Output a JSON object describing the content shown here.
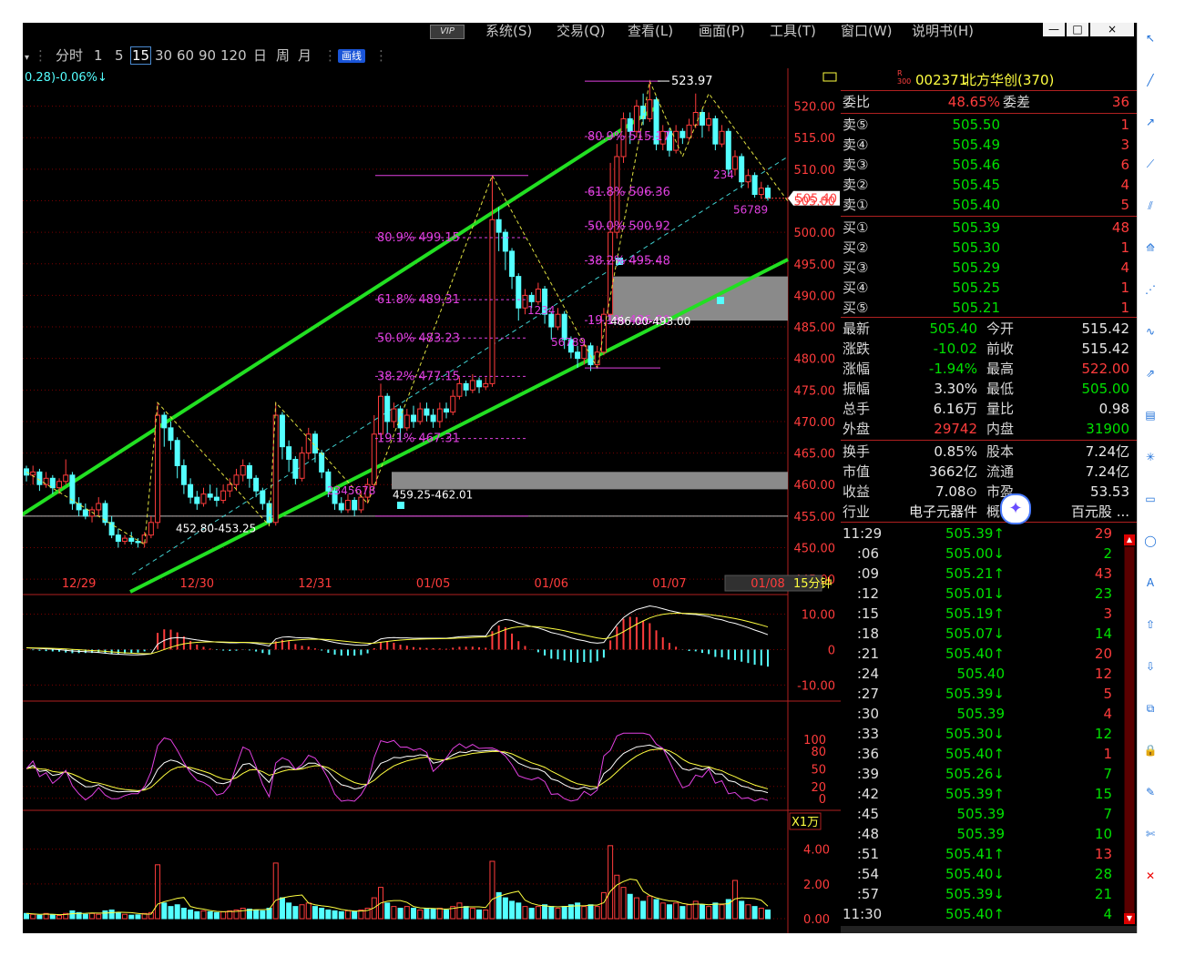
{
  "menu": {
    "vip": "VIP",
    "items": [
      "系统(S)",
      "交易(Q)",
      "查看(L)",
      "画面(P)",
      "工具(T)",
      "窗口(W)",
      "说明书(H)"
    ],
    "window_buttons": [
      "—",
      "□",
      "×"
    ]
  },
  "periods": {
    "items": [
      "分时",
      "1",
      "5",
      "15",
      "30",
      "60",
      "90",
      "120",
      "日",
      "周",
      "月"
    ],
    "selected": "15",
    "draw_label": "画线"
  },
  "chart": {
    "change_text": "0.28)-0.06%↓",
    "price_axis": [
      "520.00",
      "515.00",
      "510.00",
      "505.00",
      "500.00",
      "495.00",
      "490.00",
      "485.00",
      "480.00",
      "475.00",
      "470.00",
      "465.00",
      "460.00",
      "455.00",
      "450.00",
      "445.00"
    ],
    "current_price_tag": "505.40",
    "high_label": "523.97",
    "dates": [
      "12/29",
      "12/30",
      "12/31",
      "01/05",
      "01/06",
      "01/07",
      "01/08"
    ],
    "period_label": "15分钟",
    "fib_left": [
      "80.9% 499.15",
      "61.8% 489.31",
      "50.0% 483.23",
      "38.2% 477.15",
      "19.1% 467.31"
    ],
    "fib_right": [
      "80.9% 515.17",
      "61.8% 506.36",
      "50.0% 500.92",
      "38.2% 495.48",
      "19.1% 486.00"
    ],
    "gap_lower": "459.25-462.01",
    "gap_upper": "486.00-493.00",
    "support_label": "452.80-453.25",
    "macd_axis": [
      "10.00",
      "0",
      "-10.00"
    ],
    "kdj_axis": [
      "100",
      "80",
      "50",
      "20",
      "0"
    ],
    "vol_unit": "X1万",
    "vol_axis": [
      "4.00",
      "2.00",
      "0.00"
    ],
    "nine_turn_a": "2345678",
    "nine_turn_b": "1234",
    "nine_turn_c": "56789",
    "nine_turn_d": "234",
    "nine_turn_e": "56789"
  },
  "stock": {
    "code": "002371",
    "name": "北方华创(370)",
    "badge_top": "R",
    "badge_bottom": "300"
  },
  "order_book": {
    "weibi_label": "委比",
    "weibi": "48.65%",
    "weicha_label": "委差",
    "weicha": "36",
    "sells": [
      {
        "label": "卖⑤",
        "price": "505.50",
        "vol": "1"
      },
      {
        "label": "卖④",
        "price": "505.49",
        "vol": "3"
      },
      {
        "label": "卖③",
        "price": "505.46",
        "vol": "6"
      },
      {
        "label": "卖②",
        "price": "505.45",
        "vol": "4"
      },
      {
        "label": "卖①",
        "price": "505.40",
        "vol": "5"
      }
    ],
    "buys": [
      {
        "label": "买①",
        "price": "505.39",
        "vol": "48"
      },
      {
        "label": "买②",
        "price": "505.30",
        "vol": "1"
      },
      {
        "label": "买③",
        "price": "505.29",
        "vol": "4"
      },
      {
        "label": "买④",
        "price": "505.25",
        "vol": "1"
      },
      {
        "label": "买⑤",
        "price": "505.21",
        "vol": "1"
      }
    ]
  },
  "stats": [
    {
      "l1": "最新",
      "v1": "505.40",
      "c1": "grn",
      "l2": "今开",
      "v2": "515.42",
      "c2": "wht"
    },
    {
      "l1": "涨跌",
      "v1": "-10.02",
      "c1": "grn",
      "l2": "前收",
      "v2": "515.42",
      "c2": "wht"
    },
    {
      "l1": "涨幅",
      "v1": "-1.94%",
      "c1": "grn",
      "l2": "最高",
      "v2": "522.00",
      "c2": "red"
    },
    {
      "l1": "振幅",
      "v1": "3.30%",
      "c1": "wht",
      "l2": "最低",
      "v2": "505.00",
      "c2": "grn"
    },
    {
      "l1": "总手",
      "v1": "6.16万",
      "c1": "wht",
      "l2": "量比",
      "v2": "0.98",
      "c2": "wht"
    },
    {
      "l1": "外盘",
      "v1": "29742",
      "c1": "red",
      "l2": "内盘",
      "v2": "31900",
      "c2": "grn"
    }
  ],
  "fundamentals": [
    {
      "l1": "换手",
      "v1": "0.85%",
      "l2": "股本",
      "v2": "7.24亿"
    },
    {
      "l1": "市值",
      "v1": "3662亿",
      "l2": "流通",
      "v2": "7.24亿"
    },
    {
      "l1": "收益",
      "v1": "7.08⊙",
      "l2": "市盈",
      "v2": "53.53"
    },
    {
      "l1": "行业",
      "v1": "电子元器件",
      "l2": "概",
      "v2": "百元股 ..."
    }
  ],
  "ticks": [
    {
      "t": "11:29",
      "p": "505.39↑",
      "pc": "grn",
      "v": "29",
      "vc": "red"
    },
    {
      "t": ":06",
      "p": "505.00↓",
      "pc": "grn",
      "v": "2",
      "vc": "grn"
    },
    {
      "t": ":09",
      "p": "505.21↑",
      "pc": "grn",
      "v": "43",
      "vc": "red"
    },
    {
      "t": ":12",
      "p": "505.01↓",
      "pc": "grn",
      "v": "23",
      "vc": "grn"
    },
    {
      "t": ":15",
      "p": "505.19↑",
      "pc": "grn",
      "v": "3",
      "vc": "red"
    },
    {
      "t": ":18",
      "p": "505.07↓",
      "pc": "grn",
      "v": "14",
      "vc": "grn"
    },
    {
      "t": ":21",
      "p": "505.40↑",
      "pc": "grn",
      "v": "20",
      "vc": "red"
    },
    {
      "t": ":24",
      "p": "505.40",
      "pc": "grn",
      "v": "12",
      "vc": "red"
    },
    {
      "t": ":27",
      "p": "505.39↓",
      "pc": "grn",
      "v": "5",
      "vc": "red"
    },
    {
      "t": ":30",
      "p": "505.39",
      "pc": "grn",
      "v": "4",
      "vc": "red"
    },
    {
      "t": ":33",
      "p": "505.30↓",
      "pc": "grn",
      "v": "12",
      "vc": "grn"
    },
    {
      "t": ":36",
      "p": "505.40↑",
      "pc": "grn",
      "v": "1",
      "vc": "red"
    },
    {
      "t": ":39",
      "p": "505.26↓",
      "pc": "grn",
      "v": "7",
      "vc": "grn"
    },
    {
      "t": ":42",
      "p": "505.39↑",
      "pc": "grn",
      "v": "15",
      "vc": "grn"
    },
    {
      "t": ":45",
      "p": "505.39",
      "pc": "grn",
      "v": "7",
      "vc": "grn"
    },
    {
      "t": ":48",
      "p": "505.39",
      "pc": "grn",
      "v": "10",
      "vc": "grn"
    },
    {
      "t": ":51",
      "p": "505.41↑",
      "pc": "grn",
      "v": "13",
      "vc": "red"
    },
    {
      "t": ":54",
      "p": "505.40↓",
      "pc": "grn",
      "v": "28",
      "vc": "grn"
    },
    {
      "t": ":57",
      "p": "505.39↓",
      "pc": "grn",
      "v": "21",
      "vc": "grn"
    },
    {
      "t": "11:30",
      "p": "505.40↑",
      "pc": "grn",
      "v": "4",
      "vc": "grn"
    }
  ],
  "colors": {
    "up": "#ff3c3c",
    "down": "#54ffff",
    "channel": "#22e022",
    "fib": "#e040e0",
    "grid": "#7a0000"
  },
  "tool_icons": [
    "pointer-icon",
    "line-icon",
    "ray-icon",
    "segment-icon",
    "parallel-icon",
    "channel-icon",
    "fan-icon",
    "wave-icon",
    "arrow-icon",
    "fib-icon",
    "gann-icon",
    "rect-icon",
    "ellipse-icon",
    "text-icon",
    "up-arrow-icon",
    "down-arrow-icon",
    "copy-icon",
    "lock-icon",
    "brush-icon",
    "eraser-icon",
    "close-icon"
  ],
  "chart_data": {
    "type": "candlestick",
    "title": "",
    "ylim": [
      443,
      526
    ],
    "candles": [
      [
        462.5,
        461.5,
        463.0,
        460.5
      ],
      [
        461.5,
        462.0,
        463.0,
        460.0
      ],
      [
        462.0,
        460.0,
        462.5,
        459.0
      ],
      [
        460.0,
        461.0,
        462.0,
        459.5
      ],
      [
        461.0,
        459.5,
        461.5,
        458.5
      ],
      [
        459.5,
        460.5,
        461.0,
        458.5
      ],
      [
        460.5,
        461.5,
        464.0,
        460.0
      ],
      [
        461.5,
        457.0,
        462.0,
        456.0
      ],
      [
        457.0,
        456.0,
        458.0,
        455.0
      ],
      [
        456.0,
        455.0,
        457.0,
        454.5
      ],
      [
        455.0,
        456.0,
        456.5,
        454.0
      ],
      [
        456.0,
        457.0,
        458.0,
        455.0
      ],
      [
        457.0,
        454.0,
        457.5,
        453.5
      ],
      [
        454.0,
        452.0,
        455.0,
        451.5
      ],
      [
        452.0,
        451.0,
        453.0,
        450.0
      ],
      [
        451.0,
        451.5,
        452.0,
        450.5
      ],
      [
        451.5,
        451.0,
        452.5,
        450.5
      ],
      [
        451.0,
        450.8,
        451.5,
        450.0
      ],
      [
        450.8,
        452.0,
        452.5,
        450.0
      ],
      [
        452.0,
        454.0,
        455.0,
        451.5
      ],
      [
        454.0,
        471.0,
        473.0,
        453.0
      ],
      [
        471.0,
        469.0,
        471.5,
        466.0
      ],
      [
        469.0,
        467.0,
        470.0,
        465.5
      ],
      [
        467.0,
        463.0,
        467.5,
        461.0
      ],
      [
        463.0,
        460.0,
        464.0,
        458.5
      ],
      [
        460.0,
        458.0,
        461.0,
        457.0
      ],
      [
        458.0,
        457.0,
        459.0,
        456.0
      ],
      [
        457.0,
        458.5,
        459.5,
        456.5
      ],
      [
        458.5,
        458.0,
        460.0,
        457.5
      ],
      [
        458.0,
        457.5,
        459.5,
        456.5
      ],
      [
        457.5,
        459.0,
        460.0,
        457.0
      ],
      [
        459.0,
        460.0,
        461.0,
        458.0
      ],
      [
        460.0,
        461.5,
        462.5,
        459.0
      ],
      [
        461.5,
        463.0,
        464.0,
        460.5
      ],
      [
        463.0,
        461.0,
        463.5,
        459.5
      ],
      [
        461.0,
        459.0,
        461.5,
        458.0
      ],
      [
        459.0,
        457.0,
        459.5,
        456.0
      ],
      [
        457.0,
        454.0,
        457.5,
        453.5
      ],
      [
        454.0,
        471.0,
        473.0,
        453.5
      ],
      [
        471.0,
        466.0,
        471.5,
        464.0
      ],
      [
        466.0,
        464.0,
        467.0,
        462.0
      ],
      [
        464.0,
        461.0,
        464.5,
        460.0
      ],
      [
        461.0,
        465.0,
        466.0,
        460.5
      ],
      [
        465.0,
        468.0,
        469.0,
        464.0
      ],
      [
        468.0,
        465.0,
        468.5,
        463.5
      ],
      [
        465.0,
        462.0,
        465.5,
        461.0
      ],
      [
        462.0,
        459.0,
        462.5,
        458.0
      ],
      [
        459.0,
        457.0,
        459.5,
        456.0
      ],
      [
        457.0,
        456.0,
        458.0,
        455.5
      ],
      [
        456.0,
        457.5,
        458.5,
        455.5
      ],
      [
        457.5,
        456.0,
        458.0,
        455.0
      ],
      [
        456.0,
        458.0,
        459.0,
        455.5
      ],
      [
        458.0,
        460.0,
        461.0,
        457.0
      ],
      [
        460.0,
        468.0,
        471.0,
        459.5
      ],
      [
        468.0,
        474.0,
        476.0,
        467.0
      ],
      [
        474.0,
        470.0,
        474.5,
        468.0
      ],
      [
        470.0,
        472.0,
        473.0,
        469.0
      ],
      [
        472.0,
        469.0,
        472.5,
        467.0
      ],
      [
        469.0,
        471.0,
        472.0,
        468.5
      ],
      [
        471.0,
        470.0,
        472.5,
        469.0
      ],
      [
        470.0,
        472.0,
        473.0,
        469.5
      ],
      [
        472.0,
        471.0,
        473.0,
        470.0
      ],
      [
        471.0,
        470.0,
        472.0,
        469.0
      ],
      [
        470.0,
        472.0,
        473.0,
        469.0
      ],
      [
        472.0,
        471.5,
        473.0,
        470.5
      ],
      [
        471.5,
        474.0,
        475.0,
        471.0
      ],
      [
        474.0,
        476.0,
        477.0,
        473.5
      ],
      [
        476.0,
        475.0,
        476.5,
        474.0
      ],
      [
        475.0,
        476.5,
        477.5,
        474.5
      ],
      [
        476.5,
        475.5,
        477.0,
        474.5
      ],
      [
        475.5,
        476.0,
        477.0,
        475.0
      ],
      [
        476.0,
        502.0,
        509.0,
        475.5
      ],
      [
        502.0,
        500.0,
        504.0,
        497.0
      ],
      [
        500.0,
        497.0,
        500.5,
        494.0
      ],
      [
        497.0,
        493.0,
        497.5,
        491.0
      ],
      [
        493.0,
        488.0,
        493.5,
        486.0
      ],
      [
        488.0,
        490.0,
        491.0,
        487.0
      ],
      [
        490.0,
        489.0,
        490.5,
        488.0
      ],
      [
        489.0,
        491.0,
        492.0,
        488.5
      ],
      [
        491.0,
        487.0,
        491.5,
        485.5
      ],
      [
        487.0,
        485.0,
        487.5,
        483.0
      ],
      [
        485.0,
        487.0,
        488.0,
        484.5
      ],
      [
        487.0,
        483.0,
        487.5,
        481.5
      ],
      [
        483.0,
        481.0,
        483.5,
        480.0
      ],
      [
        481.0,
        480.0,
        482.0,
        478.5
      ],
      [
        480.0,
        482.0,
        483.0,
        479.0
      ],
      [
        482.0,
        479.0,
        482.5,
        478.0
      ],
      [
        479.0,
        481.0,
        482.0,
        478.5
      ],
      [
        481.0,
        487.0,
        488.0,
        480.5
      ],
      [
        487.0,
        500.0,
        511.0,
        486.0
      ],
      [
        500.0,
        512.0,
        514.0,
        499.0
      ],
      [
        512.0,
        518.0,
        519.0,
        511.0
      ],
      [
        518.0,
        516.0,
        519.0,
        514.0
      ],
      [
        516.0,
        520.0,
        521.0,
        515.0
      ],
      [
        520.0,
        518.0,
        522.0,
        517.0
      ],
      [
        518.0,
        521.0,
        523.97,
        517.5
      ],
      [
        521.0,
        514.0,
        521.5,
        513.0
      ],
      [
        514.0,
        516.0,
        517.0,
        513.0
      ],
      [
        516.0,
        513.0,
        516.5,
        512.0
      ],
      [
        513.0,
        516.0,
        517.0,
        512.5
      ],
      [
        516.0,
        515.0,
        516.5,
        514.0
      ],
      [
        515.0,
        517.0,
        518.0,
        514.5
      ],
      [
        517.0,
        519.0,
        522.0,
        516.5
      ],
      [
        519.0,
        517.0,
        519.5,
        515.0
      ],
      [
        517.0,
        518.0,
        519.0,
        516.0
      ],
      [
        518.0,
        514.0,
        518.5,
        513.0
      ],
      [
        514.0,
        516.0,
        517.0,
        513.5
      ],
      [
        516.0,
        510.0,
        516.5,
        509.0
      ],
      [
        510.0,
        512.0,
        513.0,
        509.0
      ],
      [
        512.0,
        508.0,
        512.5,
        507.0
      ],
      [
        508.0,
        509.0,
        510.0,
        507.0
      ],
      [
        509.0,
        506.0,
        509.5,
        505.5
      ],
      [
        506.0,
        507.0,
        508.0,
        505.5
      ],
      [
        507.0,
        505.4,
        507.5,
        505.0
      ]
    ],
    "volume": [
      0.3,
      0.25,
      0.2,
      0.3,
      0.22,
      0.18,
      0.3,
      0.45,
      0.35,
      0.25,
      0.3,
      0.25,
      0.45,
      0.5,
      0.35,
      0.25,
      0.2,
      0.22,
      0.3,
      0.35,
      3.1,
      0.9,
      0.7,
      0.8,
      0.6,
      0.5,
      0.4,
      0.45,
      0.4,
      0.35,
      0.4,
      0.45,
      0.5,
      0.6,
      0.55,
      0.5,
      0.45,
      0.6,
      3.2,
      1.2,
      0.9,
      0.7,
      0.8,
      0.9,
      0.7,
      0.6,
      0.5,
      0.45,
      0.4,
      0.45,
      0.4,
      0.5,
      0.6,
      1.2,
      1.8,
      0.9,
      0.7,
      0.6,
      0.7,
      0.6,
      0.5,
      0.6,
      0.55,
      0.6,
      0.5,
      0.7,
      0.9,
      0.7,
      0.6,
      0.5,
      0.5,
      3.3,
      1.5,
      1.2,
      1.0,
      0.9,
      0.7,
      0.6,
      0.7,
      0.8,
      0.7,
      0.6,
      0.7,
      0.8,
      0.9,
      0.7,
      0.8,
      0.7,
      1.5,
      4.2,
      2.5,
      1.8,
      1.4,
      1.2,
      1.0,
      1.3,
      1.1,
      0.9,
      0.8,
      0.9,
      0.7,
      0.8,
      1.0,
      0.8,
      0.7,
      0.9,
      0.8,
      1.1,
      2.2,
      1.0,
      0.8,
      0.7,
      0.6,
      0.5
    ],
    "macd_dif": [
      0.5,
      0.4,
      0.3,
      0.2,
      0.1,
      0.0,
      -0.2,
      -0.4,
      -0.5,
      -0.6,
      -0.7,
      -0.8,
      -1.0,
      -1.2,
      -1.3,
      -1.4,
      -1.5,
      -1.5,
      -1.4,
      -1.2,
      1.5,
      2.6,
      3.2,
      3.4,
      3.3,
      3.0,
      2.7,
      2.5,
      2.3,
      2.1,
      2.0,
      1.9,
      1.9,
      2.0,
      1.9,
      1.7,
      1.4,
      1.0,
      3.0,
      3.5,
      3.6,
      3.4,
      3.3,
      3.3,
      3.1,
      2.8,
      2.4,
      2.0,
      1.7,
      1.5,
      1.3,
      1.2,
      1.3,
      2.0,
      3.0,
      3.3,
      3.4,
      3.3,
      3.3,
      3.2,
      3.2,
      3.2,
      3.2,
      3.2,
      3.2,
      3.4,
      3.6,
      3.7,
      3.8,
      3.8,
      3.8,
      6.5,
      8.0,
      8.5,
      8.2,
      7.5,
      7.0,
      6.5,
      6.1,
      5.5,
      4.8,
      4.4,
      3.9,
      3.3,
      2.8,
      2.5,
      2.0,
      1.8,
      2.0,
      4.5,
      7.0,
      9.0,
      10.3,
      11.3,
      11.8,
      12.3,
      12.0,
      11.5,
      11.0,
      10.6,
      10.2,
      10.0,
      9.9,
      9.6,
      9.3,
      8.7,
      8.4,
      7.8,
      7.4,
      6.8,
      6.2,
      5.5,
      4.9,
      4.2
    ]
  }
}
